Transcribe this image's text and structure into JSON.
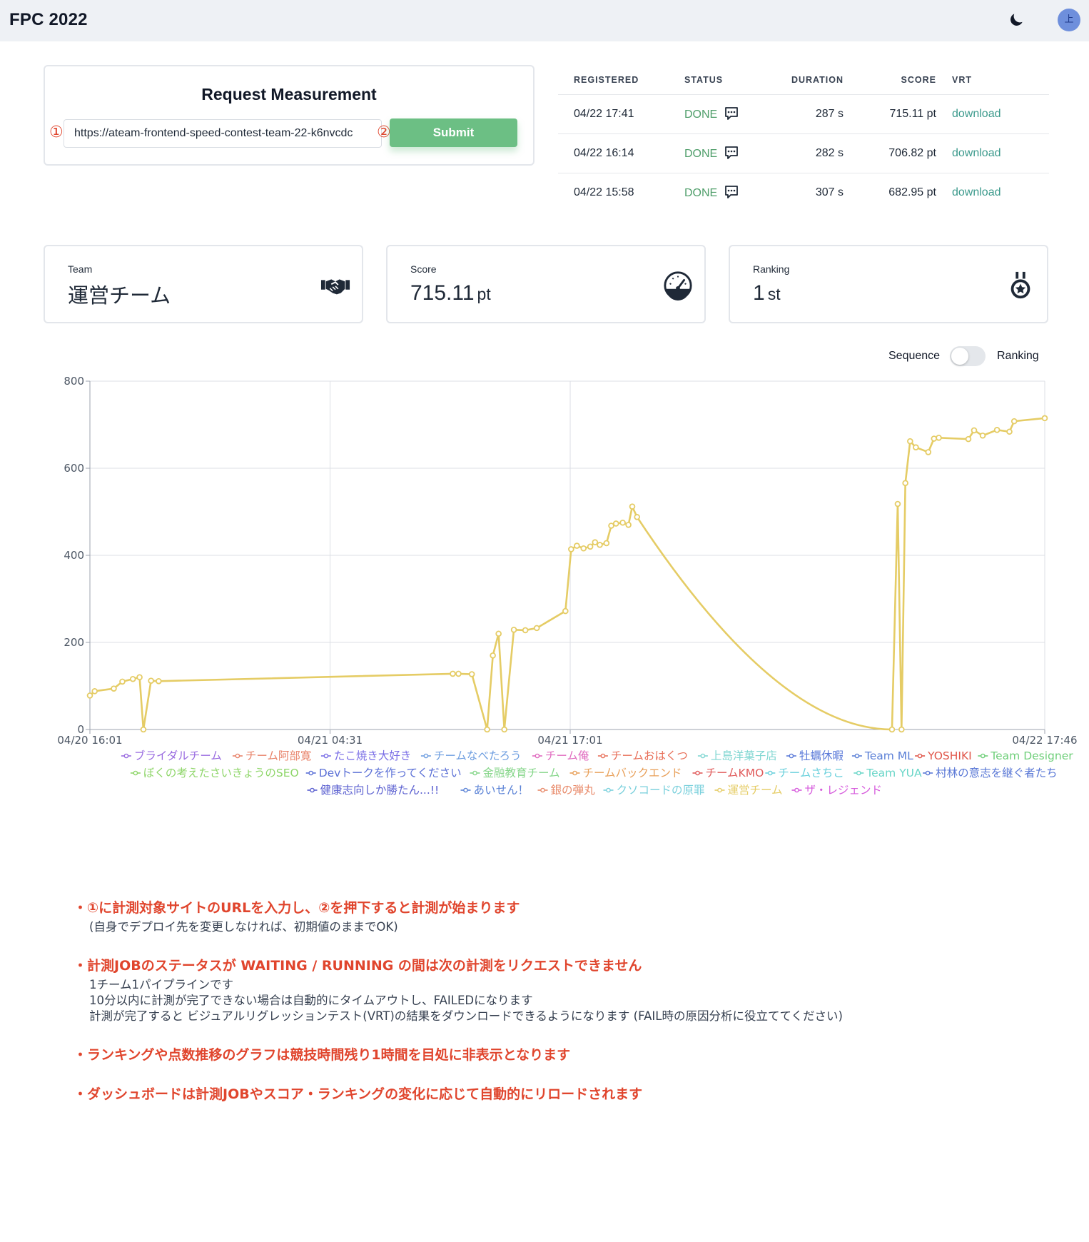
{
  "header": {
    "title": "FPC 2022",
    "avatar_text": "上",
    "theme_icon": "moon-icon"
  },
  "request": {
    "title": "Request Measurement",
    "marker1": "①",
    "marker2": "②",
    "url_value": "https://ateam-frontend-speed-contest-team-22-k6nvcdc",
    "submit_label": "Submit"
  },
  "jobs": {
    "headers": {
      "registered": "REGISTERED",
      "status": "STATUS",
      "duration": "DURATION",
      "score": "SCORE",
      "vrt": "VRT"
    },
    "rows": [
      {
        "registered": "04/22 17:41",
        "status": "DONE",
        "duration": "287 s",
        "score": "715.11 pt",
        "vrt": "download"
      },
      {
        "registered": "04/22 16:14",
        "status": "DONE",
        "duration": "282 s",
        "score": "706.82 pt",
        "vrt": "download"
      },
      {
        "registered": "04/22 15:58",
        "status": "DONE",
        "duration": "307 s",
        "score": "682.95 pt",
        "vrt": "download"
      }
    ]
  },
  "stats": {
    "team": {
      "label": "Team",
      "value": "運営チーム",
      "icon": "handshake-icon"
    },
    "score": {
      "label": "Score",
      "value": "715.11",
      "unit": "pt",
      "icon": "speedometer-icon"
    },
    "ranking": {
      "label": "Ranking",
      "value": "1",
      "unit": "st",
      "icon": "medal-icon"
    }
  },
  "toggle": {
    "left_label": "Sequence",
    "right_label": "Ranking",
    "state": "off"
  },
  "chart_data": {
    "type": "line",
    "x_tick_labels": [
      "04/20 16:01",
      "04/21 04:31",
      "04/21 17:01",
      "04/22 17:46"
    ],
    "ylim": [
      0,
      800
    ],
    "y_ticks": [
      0,
      200,
      400,
      600,
      800
    ],
    "grid": true,
    "legend_position": "bottom",
    "legend": [
      {
        "name": "ブライダルチーム",
        "color": "#9a6ce0"
      },
      {
        "name": "チーム阿部寛",
        "color": "#e8836a"
      },
      {
        "name": "たこ焼き大好き",
        "color": "#7a6ee6"
      },
      {
        "name": "チームなべたろう",
        "color": "#6e9ee0"
      },
      {
        "name": "チーム俺",
        "color": "#e06bbf"
      },
      {
        "name": "チームおはくつ",
        "color": "#e8705a"
      },
      {
        "name": "上島洋菓子店",
        "color": "#7fd6d1"
      },
      {
        "name": "牡蠣休暇",
        "color": "#5c7bd9"
      },
      {
        "name": "Team ML",
        "color": "#5a7fd6"
      },
      {
        "name": "YOSHIKI",
        "color": "#e0564a"
      },
      {
        "name": "Team Designer",
        "color": "#6fcf7a"
      },
      {
        "name": "ぼくの考えたさいきょうのSEO",
        "color": "#8fd66a"
      },
      {
        "name": "Devトークを作ってください",
        "color": "#5a6fd6"
      },
      {
        "name": "金融教育チーム",
        "color": "#86d68a"
      },
      {
        "name": "チームバックエンド",
        "color": "#e8a05a"
      },
      {
        "name": "チームKMO",
        "color": "#e05a5a"
      },
      {
        "name": "チームさちこ",
        "color": "#6ad0dc"
      },
      {
        "name": "Team YUA",
        "color": "#6ad6c8"
      },
      {
        "name": "村林の意志を継ぐ者たち",
        "color": "#5a78d6"
      },
      {
        "name": "健康志向しか勝たん...!!",
        "color": "#5a5fd0"
      },
      {
        "name": "あいせん！",
        "color": "#5a82d6"
      },
      {
        "name": "銀の弾丸",
        "color": "#e88a6a"
      },
      {
        "name": "クソコードの原罪",
        "color": "#7ad0dc"
      },
      {
        "name": "運営チーム",
        "color": "#e5cc65"
      },
      {
        "name": "ザ・レジェンド",
        "color": "#d65adc"
      }
    ],
    "series": [
      {
        "name": "運営チーム",
        "color": "#e5cc65",
        "points": [
          [
            0.0,
            78
          ],
          [
            0.5,
            88
          ],
          [
            2.5,
            94
          ],
          [
            3.4,
            110
          ],
          [
            4.5,
            116
          ],
          [
            5.2,
            120
          ],
          [
            5.6,
            0
          ],
          [
            6.4,
            112
          ],
          [
            7.2,
            111
          ],
          [
            38.0,
            128
          ],
          [
            38.6,
            128
          ],
          [
            40.0,
            127
          ],
          [
            41.6,
            0
          ],
          [
            42.2,
            170
          ],
          [
            42.8,
            220
          ],
          [
            43.4,
            0
          ],
          [
            44.4,
            229
          ],
          [
            45.6,
            228
          ],
          [
            46.8,
            233
          ],
          [
            49.8,
            272
          ],
          [
            50.4,
            414
          ],
          [
            51.0,
            422
          ],
          [
            51.7,
            416
          ],
          [
            52.4,
            420
          ],
          [
            52.9,
            430
          ],
          [
            53.4,
            424
          ],
          [
            54.1,
            428
          ],
          [
            54.6,
            468
          ],
          [
            55.1,
            473
          ],
          [
            55.8,
            475
          ],
          [
            56.4,
            470
          ],
          [
            56.8,
            512
          ],
          [
            57.3,
            488
          ],
          [
            84.0,
            0
          ],
          [
            84.6,
            518
          ],
          [
            85.0,
            0
          ],
          [
            85.4,
            566
          ],
          [
            85.9,
            662
          ],
          [
            86.5,
            648
          ],
          [
            87.8,
            637
          ],
          [
            88.4,
            668
          ],
          [
            88.9,
            670
          ],
          [
            92.0,
            667
          ],
          [
            92.6,
            687
          ],
          [
            93.5,
            675
          ],
          [
            95.0,
            688
          ],
          [
            96.3,
            684
          ],
          [
            96.8,
            708
          ],
          [
            100.0,
            715
          ]
        ]
      }
    ]
  },
  "notes": [
    {
      "heading": "・①に計測対象サイトのURLを入力し、②を押下すると計測が始まります",
      "lines": [
        "(自身でデプロイ先を変更しなければ、初期値のままでOK)"
      ]
    },
    {
      "heading": "・計測JOBのステータスが WAITING / RUNNING の間は次の計測をリクエストできません",
      "lines": [
        "1チーム1パイプラインです",
        "10分以内に計測が完了できない場合は自動的にタイムアウトし、FAILEDになります",
        "計測が完了すると ビジュアルリグレッションテスト(VRT)の結果をダウンロードできるようになります (FAIL時の原因分析に役立ててください)"
      ]
    },
    {
      "heading": "・ランキングや点数推移のグラフは競技時間残り1時間を目処に非表示となります",
      "lines": []
    },
    {
      "heading": "・ダッシュボードは計測JOBやスコア・ランキングの変化に応じて自動的にリロードされます",
      "lines": []
    }
  ]
}
